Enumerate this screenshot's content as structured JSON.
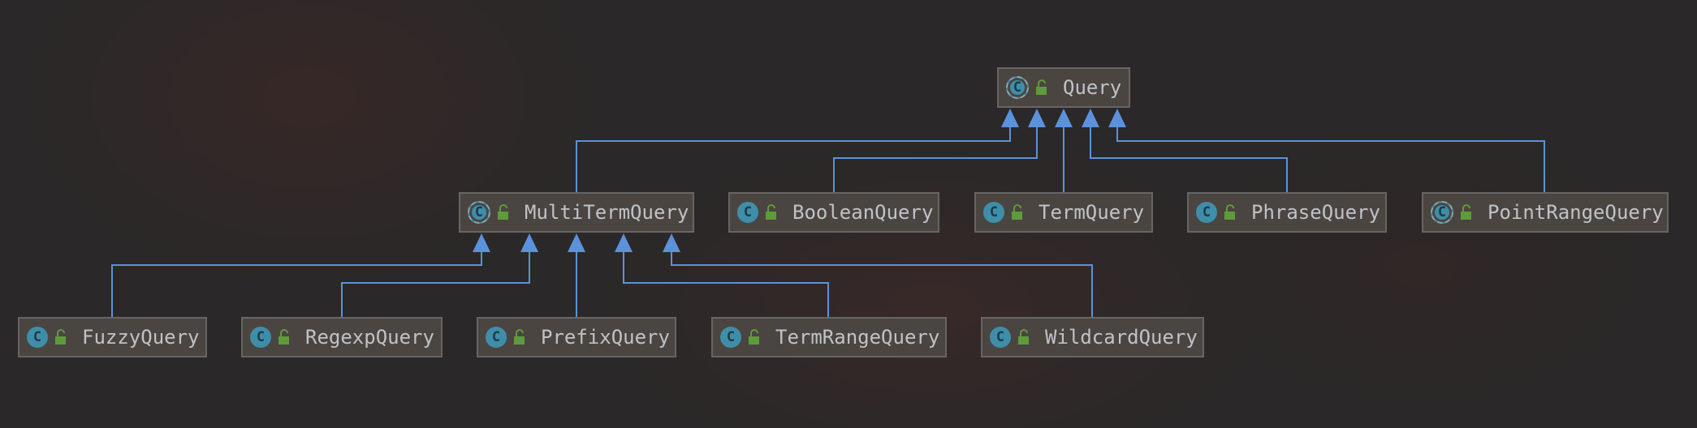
{
  "diagram": {
    "colors": {
      "edge": "#5b92db",
      "node_bg": "#4b4542",
      "node_border": "#676563",
      "text": "#bfc3c6",
      "class_icon": "#3f8ea9",
      "lock_icon": "#5e9b3a"
    },
    "root": {
      "label": "Query",
      "icon": "abstract-class-icon",
      "visibility_icon": "unlocked-icon"
    },
    "level1": [
      {
        "label": "MultiTermQuery",
        "icon": "abstract-class-icon",
        "visibility_icon": "unlocked-icon"
      },
      {
        "label": "BooleanQuery",
        "icon": "class-icon",
        "visibility_icon": "unlocked-icon"
      },
      {
        "label": "TermQuery",
        "icon": "class-icon",
        "visibility_icon": "unlocked-icon"
      },
      {
        "label": "PhraseQuery",
        "icon": "class-icon",
        "visibility_icon": "unlocked-icon"
      },
      {
        "label": "PointRangeQuery",
        "icon": "abstract-class-icon",
        "visibility_icon": "unlocked-icon"
      }
    ],
    "level2": [
      {
        "label": "FuzzyQuery",
        "icon": "class-icon",
        "visibility_icon": "unlocked-icon"
      },
      {
        "label": "RegexpQuery",
        "icon": "class-icon",
        "visibility_icon": "unlocked-icon"
      },
      {
        "label": "PrefixQuery",
        "icon": "class-icon",
        "visibility_icon": "unlocked-icon"
      },
      {
        "label": "TermRangeQuery",
        "icon": "class-icon",
        "visibility_icon": "unlocked-icon"
      },
      {
        "label": "WildcardQuery",
        "icon": "class-icon",
        "visibility_icon": "unlocked-icon"
      }
    ],
    "icon_letter": "C"
  }
}
